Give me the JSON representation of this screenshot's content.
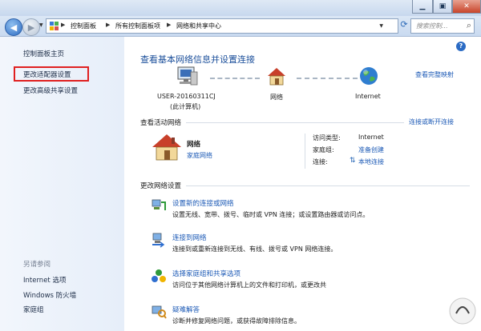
{
  "toolbar": {
    "breadcrumb": [
      "控制面板",
      "所有控制面板项",
      "网络和共享中心"
    ],
    "search_placeholder": "搜索控制...",
    "refresh_icon": "refresh-icon"
  },
  "sidebar": {
    "home_link": "控制面板主页",
    "adapter_link": "更改适配器设置",
    "advanced_sharing_link": "更改高级共享设置",
    "see_also_title": "另请参阅",
    "see_also_items": [
      "Internet 选项",
      "Windows 防火墙",
      "家庭组"
    ],
    "highlight_color": "#e02020"
  },
  "main": {
    "heading": "查看基本网络信息并设置连接",
    "full_map_link": "查看完整映射",
    "computer_name": "USER-20160311CJ",
    "computer_sub": "(此计算机)",
    "network_label": "网络",
    "internet_label": "Internet",
    "active_title": "查看活动网络",
    "connect_disconnect_link": "连接或断开连接",
    "active_network": {
      "name": "网络",
      "type_link": "家庭网络",
      "access_type_label": "访问类型:",
      "access_type_value": "Internet",
      "homegroup_label": "家庭组:",
      "homegroup_value": "准备创建",
      "connection_label": "连接:",
      "connection_value": "本地连接"
    },
    "change_title": "更改网络设置",
    "settings": [
      {
        "title": "设置新的连接或网络",
        "desc": "设置无线、宽带、拨号、临时或 VPN 连接；或设置路由器或访问点。"
      },
      {
        "title": "连接到网络",
        "desc": "连接到或重新连接到无线、有线、拨号或 VPN 网络连接。"
      },
      {
        "title": "选择家庭组和共享选项",
        "desc": "访问位于其他网络计算机上的文件和打印机，或更改共"
      },
      {
        "title": "疑难解答",
        "desc": "诊断并修复网络问题，或获得故障排除信息。"
      }
    ]
  }
}
